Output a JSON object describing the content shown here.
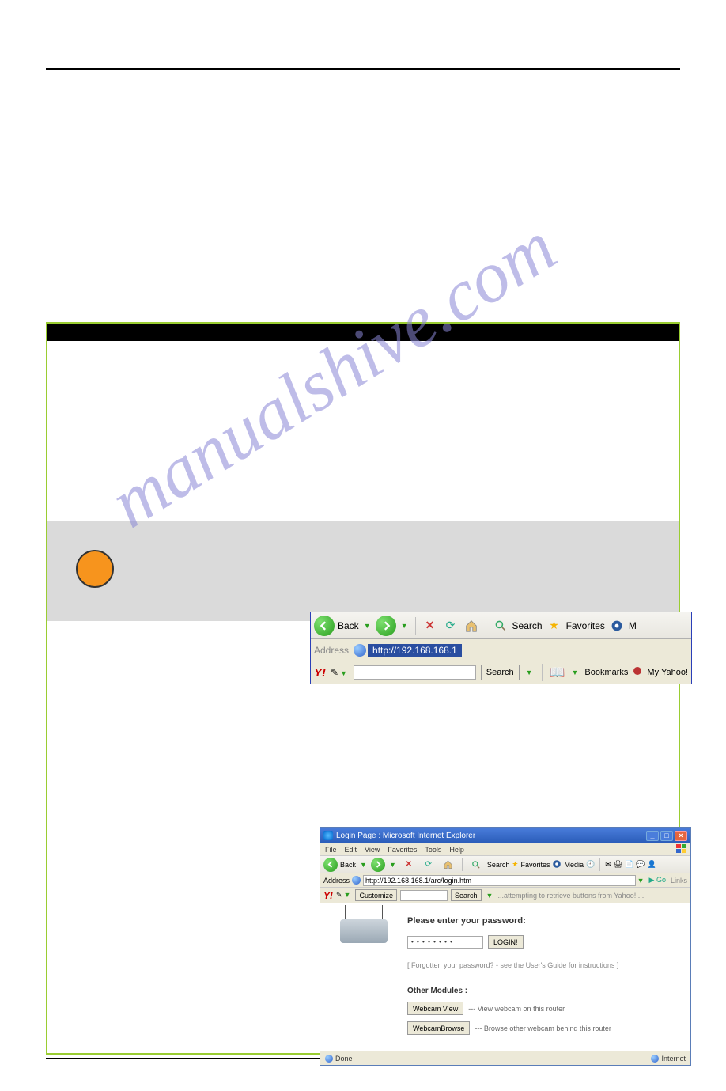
{
  "watermark": "manualshive.com",
  "toolbar": {
    "back": "Back",
    "search": "Search",
    "favorites": "Favorites",
    "media_prefix": "M"
  },
  "address": {
    "label": "Address",
    "url": "http://192.168.168.1"
  },
  "yahoo": {
    "logo": "Y!",
    "search_btn": "Search",
    "bookmarks": "Bookmarks",
    "my_yahoo": "My Yahoo!"
  },
  "login_window": {
    "title": "Login Page  :  Microsoft Internet Explorer",
    "menus": [
      "File",
      "Edit",
      "View",
      "Favorites",
      "Tools",
      "Help"
    ],
    "mini_toolbar": {
      "back": "Back",
      "search": "Search",
      "favorites": "Favorites",
      "media": "Media"
    },
    "addr_label": "Address",
    "addr_url": "http://192.168.168.1/arc/login.htm",
    "go": "Go",
    "links": "Links",
    "y_customize": "Customize",
    "y_search": "Search",
    "y_status": "...attempting to retrieve buttons from Yahoo! ...",
    "heading": "Please enter your password:",
    "pwd_mask": "• • • • • • • •",
    "login_btn": "LOGIN!",
    "forgot": "[ Forgotten your password? - see the User's Guide for instructions ]",
    "modules_h": "Other Modules :",
    "webcam_view_btn": "Webcam View",
    "webcam_view_desc": "--- View webcam on this router",
    "webcam_browse_btn": "WebcamBrowse",
    "webcam_browse_desc": "--- Browse other webcam behind this router",
    "status_done": "Done",
    "status_zone": "Internet"
  }
}
